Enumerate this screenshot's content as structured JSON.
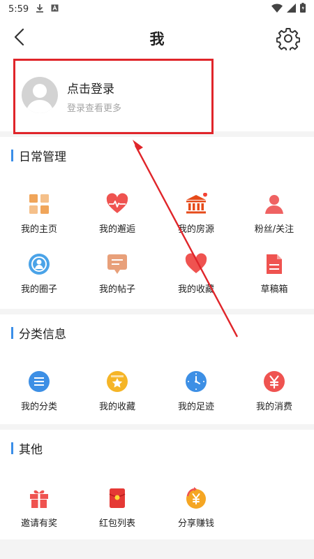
{
  "status_bar": {
    "time": "5:59"
  },
  "header": {
    "title": "我"
  },
  "login": {
    "title": "点击登录",
    "subtitle": "登录查看更多"
  },
  "sections": {
    "daily": {
      "title": "日常管理",
      "items": [
        {
          "label": "我的主页",
          "icon": "grid-icon",
          "color": "#f0a55a"
        },
        {
          "label": "我的邂逅",
          "icon": "heartbeat-icon",
          "color": "#ef5350"
        },
        {
          "label": "我的房源",
          "icon": "building-icon",
          "color": "#e64a19"
        },
        {
          "label": "粉丝/关注",
          "icon": "person-icon",
          "color": "#ef6262"
        },
        {
          "label": "我的圈子",
          "icon": "circle-icon",
          "color": "#4aa3e8"
        },
        {
          "label": "我的帖子",
          "icon": "message-icon",
          "color": "#e8a07a"
        },
        {
          "label": "我的收藏",
          "icon": "heart-icon",
          "color": "#ef5350"
        },
        {
          "label": "草稿箱",
          "icon": "document-icon",
          "color": "#ef5350"
        }
      ]
    },
    "category": {
      "title": "分类信息",
      "items": [
        {
          "label": "我的分类",
          "icon": "list-icon",
          "color": "#3d8fe5"
        },
        {
          "label": "我的收藏",
          "icon": "star-icon",
          "color": "#f5b527"
        },
        {
          "label": "我的足迹",
          "icon": "clock-icon",
          "color": "#3d8fe5"
        },
        {
          "label": "我的消费",
          "icon": "yen-icon",
          "color": "#ef5350"
        }
      ]
    },
    "other": {
      "title": "其他",
      "items": [
        {
          "label": "邀请有奖",
          "icon": "gift-icon",
          "color": "#ef5350"
        },
        {
          "label": "红包列表",
          "icon": "red-envelope-icon",
          "color": "#e53935"
        },
        {
          "label": "分享赚钱",
          "icon": "share-money-icon",
          "color": "#f5a623"
        }
      ]
    }
  }
}
